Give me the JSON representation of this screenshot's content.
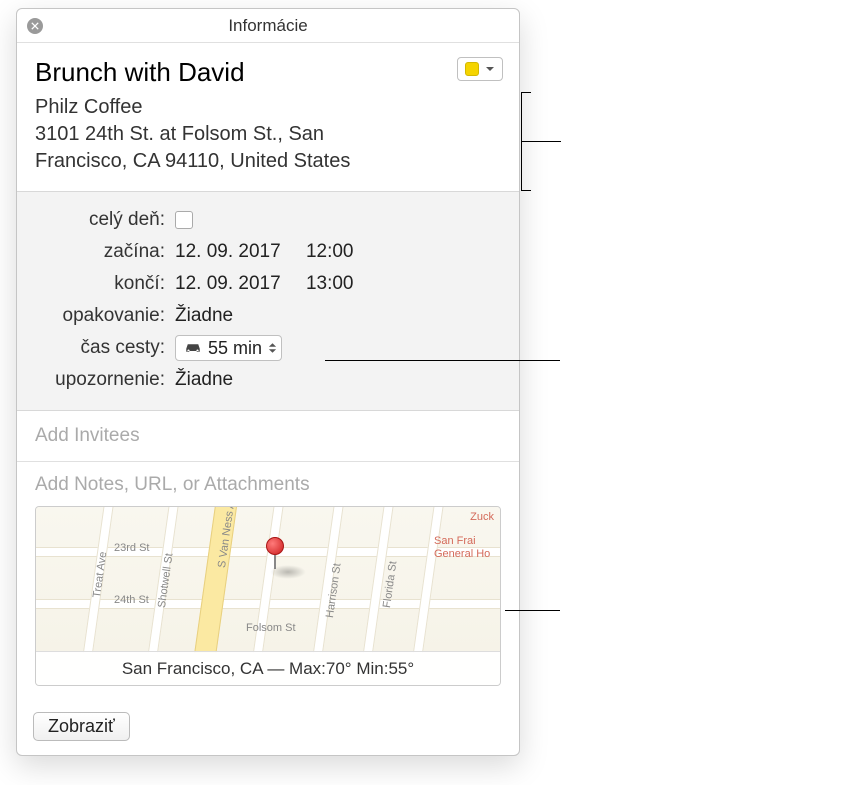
{
  "window": {
    "title": "Informácie"
  },
  "event": {
    "title": "Brunch with David",
    "location_name": "Philz Coffee",
    "location_addr_line1": "3101 24th St. at Folsom St., San",
    "location_addr_line2": "Francisco, CA 94110, United States",
    "calendar_color": "#f5d400"
  },
  "labels": {
    "all_day": "celý deň:",
    "starts": "začína:",
    "ends": "končí:",
    "repeat": "opakovanie:",
    "travel": "čas cesty:",
    "alert": "upozornenie:"
  },
  "values": {
    "all_day_checked": false,
    "starts_date": "12. 09. 2017",
    "starts_time": "12:00",
    "ends_date": "12. 09. 2017",
    "ends_time": "13:00",
    "repeat": "Žiadne",
    "travel": "55 min",
    "alert": "Žiadne"
  },
  "placeholders": {
    "invitees": "Add Invitees",
    "notes": "Add Notes, URL, or Attachments"
  },
  "map": {
    "weather": "San Francisco, CA — Max:70° Min:55°",
    "streets": {
      "s23": "23rd St",
      "s24": "24th St",
      "folsom": "Folsom St",
      "harrison": "Harrison St",
      "shotwell": "Shotwell St",
      "vanness": "S Van Ness Ave",
      "florida": "Florida St",
      "treat": "Treat Ave"
    },
    "poi": {
      "zuck": "Zuck",
      "sfgh": "San Frai General Ho"
    }
  },
  "footer": {
    "show": "Zobraziť"
  }
}
